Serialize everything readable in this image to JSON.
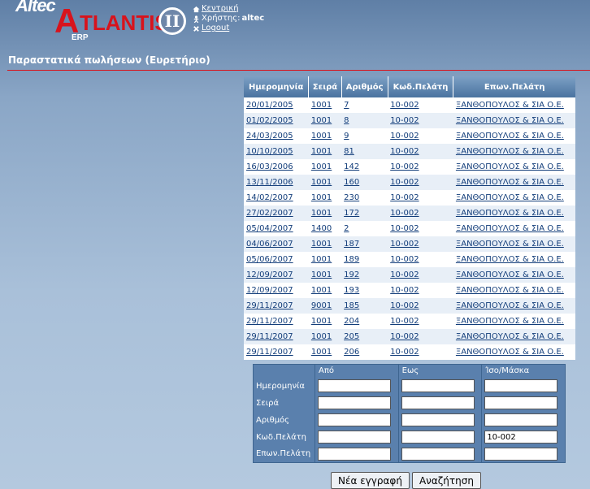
{
  "logo": {
    "altec": "Altec",
    "big_a": "A",
    "tlantis": "TLANTIS",
    "erp": "ERP",
    "numeral": "II"
  },
  "userlinks": {
    "home": "Κεντρική",
    "user_label": "Χρήστης:",
    "user_name": "altec",
    "logout": "Logout"
  },
  "page_title": "Παραστατικά πωλήσεων (Ευρετήριο)",
  "results": {
    "headers": [
      "Ημερομηνία",
      "Σειρά",
      "Αριθμός",
      "Κωδ.Πελάτη",
      "Επων.Πελάτη"
    ],
    "rows": [
      [
        "20/01/2005",
        "1001",
        "7",
        "10-002",
        "ΞΑΝΘΟΠΟΥΛΟΣ & ΣΙΑ Ο.Ε."
      ],
      [
        "01/02/2005",
        "1001",
        "8",
        "10-002",
        "ΞΑΝΘΟΠΟΥΛΟΣ & ΣΙΑ Ο.Ε."
      ],
      [
        "24/03/2005",
        "1001",
        "9",
        "10-002",
        "ΞΑΝΘΟΠΟΥΛΟΣ & ΣΙΑ Ο.Ε."
      ],
      [
        "10/10/2005",
        "1001",
        "81",
        "10-002",
        "ΞΑΝΘΟΠΟΥΛΟΣ & ΣΙΑ Ο.Ε."
      ],
      [
        "16/03/2006",
        "1001",
        "142",
        "10-002",
        "ΞΑΝΘΟΠΟΥΛΟΣ & ΣΙΑ Ο.Ε."
      ],
      [
        "13/11/2006",
        "1001",
        "160",
        "10-002",
        "ΞΑΝΘΟΠΟΥΛΟΣ & ΣΙΑ Ο.Ε."
      ],
      [
        "14/02/2007",
        "1001",
        "230",
        "10-002",
        "ΞΑΝΘΟΠΟΥΛΟΣ & ΣΙΑ Ο.Ε."
      ],
      [
        "27/02/2007",
        "1001",
        "172",
        "10-002",
        "ΞΑΝΘΟΠΟΥΛΟΣ & ΣΙΑ Ο.Ε."
      ],
      [
        "05/04/2007",
        "1400",
        "2",
        "10-002",
        "ΞΑΝΘΟΠΟΥΛΟΣ & ΣΙΑ Ο.Ε."
      ],
      [
        "04/06/2007",
        "1001",
        "187",
        "10-002",
        "ΞΑΝΘΟΠΟΥΛΟΣ & ΣΙΑ Ο.Ε."
      ],
      [
        "05/06/2007",
        "1001",
        "189",
        "10-002",
        "ΞΑΝΘΟΠΟΥΛΟΣ & ΣΙΑ Ο.Ε."
      ],
      [
        "12/09/2007",
        "1001",
        "192",
        "10-002",
        "ΞΑΝΘΟΠΟΥΛΟΣ & ΣΙΑ Ο.Ε."
      ],
      [
        "12/09/2007",
        "1001",
        "193",
        "10-002",
        "ΞΑΝΘΟΠΟΥΛΟΣ & ΣΙΑ Ο.Ε."
      ],
      [
        "29/11/2007",
        "9001",
        "185",
        "10-002",
        "ΞΑΝΘΟΠΟΥΛΟΣ & ΣΙΑ Ο.Ε."
      ],
      [
        "29/11/2007",
        "1001",
        "204",
        "10-002",
        "ΞΑΝΘΟΠΟΥΛΟΣ & ΣΙΑ Ο.Ε."
      ],
      [
        "29/11/2007",
        "1001",
        "205",
        "10-002",
        "ΞΑΝΘΟΠΟΥΛΟΣ & ΣΙΑ Ο.Ε."
      ],
      [
        "29/11/2007",
        "1001",
        "206",
        "10-002",
        "ΞΑΝΘΟΠΟΥΛΟΣ & ΣΙΑ Ο.Ε."
      ]
    ]
  },
  "search": {
    "col_from": "Από",
    "col_to": "Εως",
    "col_equal": "Ίσο/Μάσκα",
    "fields": [
      {
        "label": "Ημερομηνία",
        "from": "",
        "to": "",
        "equal": ""
      },
      {
        "label": "Σειρά",
        "from": "",
        "to": "",
        "equal": ""
      },
      {
        "label": "Αριθμός",
        "from": "",
        "to": "",
        "equal": ""
      },
      {
        "label": "Κωδ.Πελάτη",
        "from": "",
        "to": "",
        "equal": "10-002"
      },
      {
        "label": "Επων.Πελάτη",
        "from": "",
        "to": "",
        "equal": ""
      }
    ]
  },
  "buttons": {
    "new_label": "Νέα εγγραφή",
    "search_label": "Αναζήτηση"
  },
  "colors": {
    "accent_red": "#d8131c",
    "header_blue": "#4a73a0",
    "link_blue": "#123d7a"
  }
}
